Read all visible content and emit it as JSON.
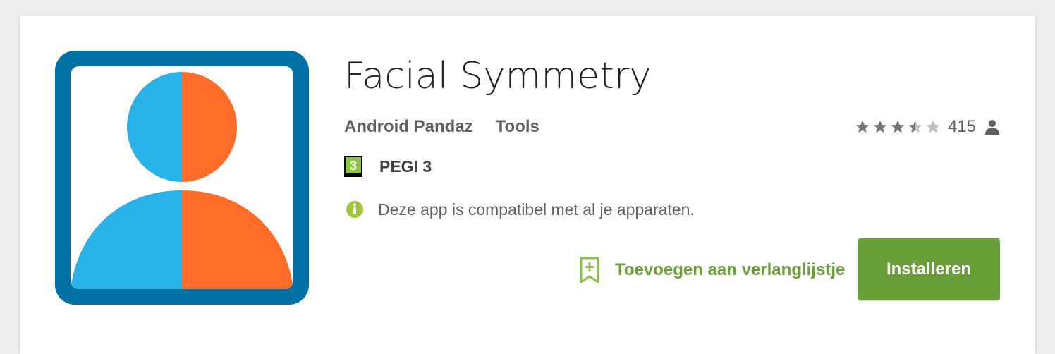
{
  "app": {
    "title": "Facial Symmetry",
    "developer": "Android Pandaz",
    "category": "Tools",
    "icon": {
      "name": "facial-symmetry-app-icon",
      "frame_color": "#0071a4",
      "left_color": "#29b2e8",
      "right_color": "#ff6d28",
      "background_color": "#ffffff"
    }
  },
  "rating": {
    "stars": 3.5,
    "max_stars": 5,
    "count": "415",
    "count_icon": "person-icon",
    "star_color": "#757575",
    "star_empty_color": "#bdbdbd"
  },
  "content_rating": {
    "badge_number": "3",
    "label": "PEGI 3",
    "badge_color": "#8cc63f"
  },
  "compatibility": {
    "icon": "info-icon",
    "icon_color": "#a4c639",
    "text": "Deze app is compatibel met al je apparaten."
  },
  "actions": {
    "wishlist_label": "Toevoegen aan verlanglijstje",
    "wishlist_icon": "bookmark-add-icon",
    "install_label": "Installeren",
    "accent_color": "#689f38"
  }
}
